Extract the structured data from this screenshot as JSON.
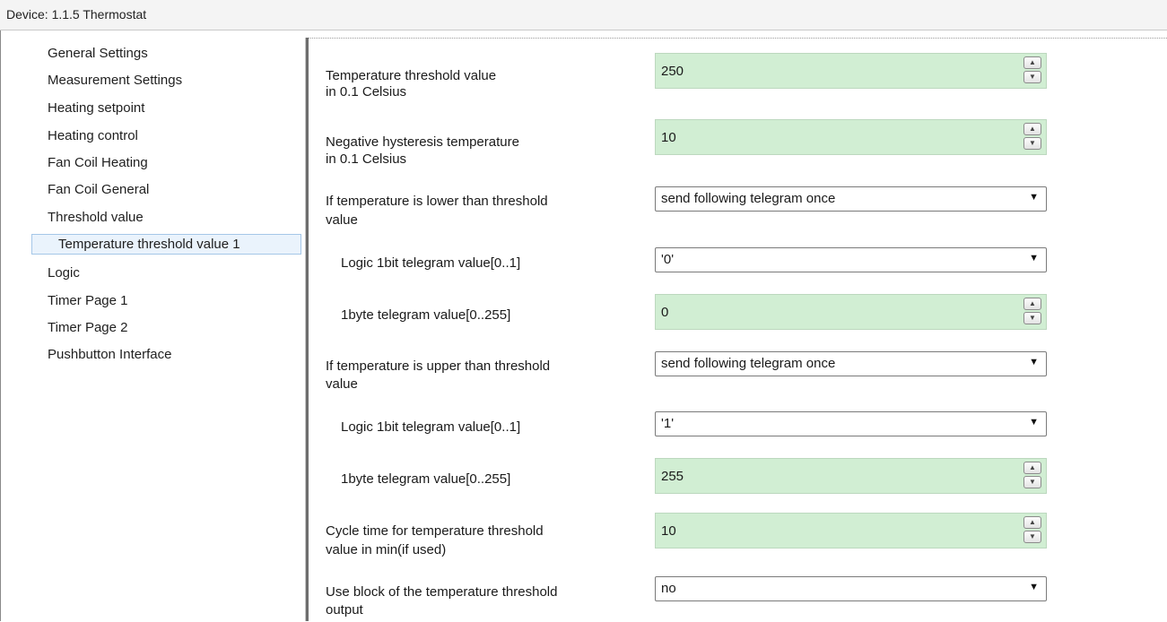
{
  "window": {
    "title": "Device: 1.1.5  Thermostat"
  },
  "sidebar": {
    "items": [
      {
        "label": "General Settings"
      },
      {
        "label": "Measurement Settings"
      },
      {
        "label": "Heating setpoint"
      },
      {
        "label": "Heating control"
      },
      {
        "label": "Fan Coil Heating"
      },
      {
        "label": "Fan Coil General"
      },
      {
        "label": "Threshold value"
      },
      {
        "label": "Temperature threshold value 1"
      },
      {
        "label": "Logic"
      },
      {
        "label": "Timer Page 1"
      },
      {
        "label": "Timer Page 2"
      },
      {
        "label": "Pushbutton Interface"
      }
    ]
  },
  "params": {
    "threshold": {
      "label1": "Temperature threshold value",
      "label2": "in 0.1 Celsius",
      "value": "250"
    },
    "hysteresis": {
      "label1": "Negative hysteresis temperature",
      "label2": "in 0.1 Celsius",
      "value": "10"
    },
    "lower_mode": {
      "label1": "If temperature is lower than threshold",
      "label2": "value",
      "value": "send following telegram once"
    },
    "lower_1bit": {
      "label": "Logic 1bit telegram value[0..1]",
      "value": "'0'"
    },
    "lower_1byte": {
      "label": "1byte telegram value[0..255]",
      "value": "0"
    },
    "upper_mode": {
      "label1": "If temperature is upper than threshold",
      "label2": "value",
      "value": "send following telegram once"
    },
    "upper_1bit": {
      "label": "Logic 1bit telegram value[0..1]",
      "value": "'1'"
    },
    "upper_1byte": {
      "label": "1byte telegram value[0..255]",
      "value": "255"
    },
    "cycle": {
      "label1": "Cycle time for temperature threshold",
      "label2": "value in min(if used)",
      "value": "10"
    },
    "block": {
      "label1": "Use block of the temperature threshold",
      "label2": "output",
      "value": "no"
    }
  },
  "colors": {
    "spin_bg": "#d1eed3",
    "selected_bg": "#eaf3fc"
  },
  "icons": {
    "spin_up": "triangle-up",
    "spin_down": "triangle-down",
    "dropdown": "triangle-down"
  }
}
